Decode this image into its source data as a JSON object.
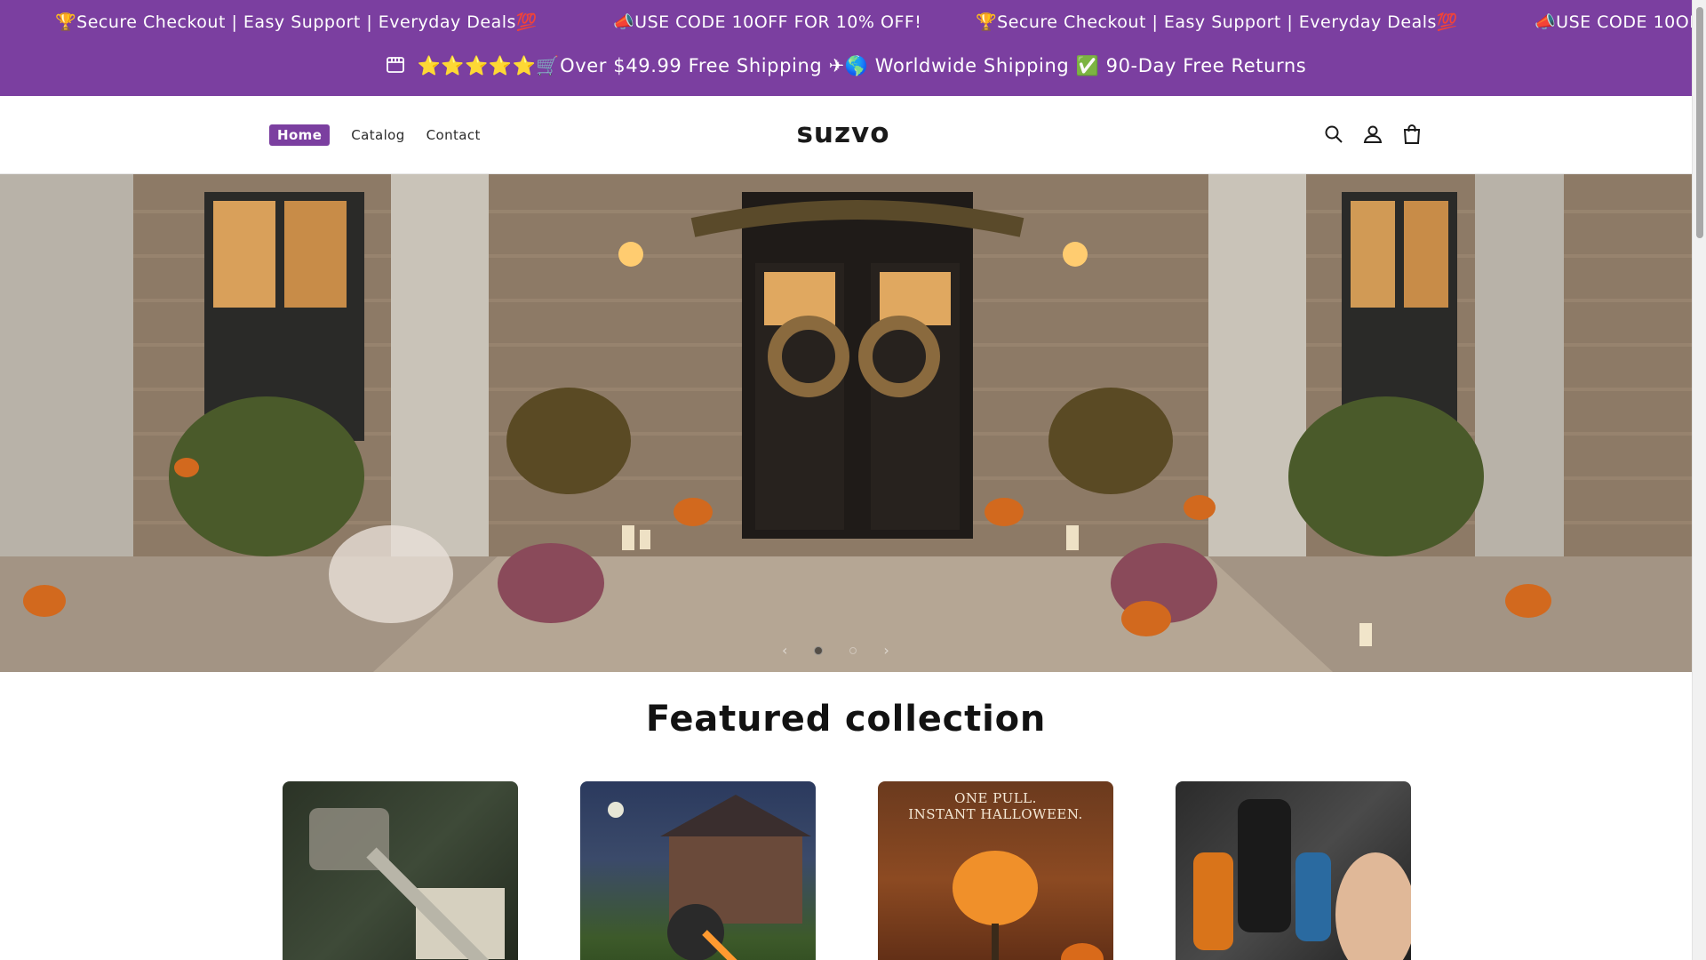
{
  "announcement": {
    "marquee_items": [
      "🏆Secure Checkout | Easy Support | Everyday Deals💯",
      "📣USE CODE 10OFF FOR 10% OFF!",
      "🏆Secure Checkout | Easy Support | Everyday Deals💯",
      "📣USE CODE 10OFF"
    ],
    "shipping_line": "⭐⭐⭐⭐⭐🛒Over $49.99 Free Shipping ✈🌎 Worldwide Shipping ✅ 90-Day Free Returns",
    "background_color": "#7b3fa0"
  },
  "header": {
    "nav": [
      {
        "label": "Home",
        "active": true
      },
      {
        "label": "Catalog",
        "active": false
      },
      {
        "label": "Contact",
        "active": false
      }
    ],
    "logo": "suzvo",
    "icons": [
      "search-icon",
      "account-icon",
      "cart-icon"
    ]
  },
  "hero": {
    "slider": {
      "prev_icon": "chevron-left-icon",
      "next_icon": "chevron-right-icon",
      "slide_count": 2,
      "active_slide": 1
    }
  },
  "featured": {
    "title": "Featured collection",
    "products": [
      {
        "image_text": ""
      },
      {
        "image_text": ""
      },
      {
        "image_text": "ONE PULL.\nINSTANT HALLOWEEN."
      },
      {
        "image_text": ""
      }
    ]
  },
  "colors": {
    "accent": "#7b3fa0",
    "text": "#121212"
  }
}
